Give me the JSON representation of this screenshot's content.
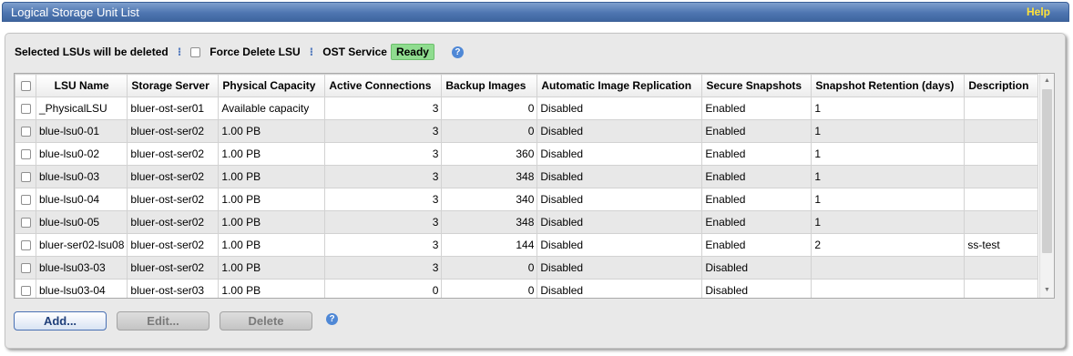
{
  "header": {
    "title": "Logical Storage Unit List",
    "help_label": "Help"
  },
  "toolbar": {
    "selected_label": "Selected LSUs will be deleted",
    "separator": "⁝",
    "force_delete_label": "Force Delete LSU",
    "force_delete_checked": false,
    "ost_service_label": "OST Service",
    "ost_status": "Ready",
    "status_color": "#8fdc8f"
  },
  "table": {
    "columns": [
      "LSU Name",
      "Storage Server",
      "Physical Capacity",
      "Active Connections",
      "Backup Images",
      "Automatic Image Replication",
      "Secure Snapshots",
      "Snapshot Retention (days)",
      "Description"
    ],
    "rows": [
      {
        "name": "_PhysicalLSU",
        "server": "bluer-ost-ser01",
        "capacity": "Available capacity",
        "connections": "3",
        "images": "0",
        "replication": "Disabled",
        "snapshots": "Enabled",
        "retention": "1",
        "description": ""
      },
      {
        "name": "blue-lsu0-01",
        "server": "bluer-ost-ser02",
        "capacity": "1.00 PB",
        "connections": "3",
        "images": "0",
        "replication": "Disabled",
        "snapshots": "Enabled",
        "retention": "1",
        "description": ""
      },
      {
        "name": "blue-lsu0-02",
        "server": "bluer-ost-ser02",
        "capacity": "1.00 PB",
        "connections": "3",
        "images": "360",
        "replication": "Disabled",
        "snapshots": "Enabled",
        "retention": "1",
        "description": ""
      },
      {
        "name": "blue-lsu0-03",
        "server": "bluer-ost-ser02",
        "capacity": "1.00 PB",
        "connections": "3",
        "images": "348",
        "replication": "Disabled",
        "snapshots": "Enabled",
        "retention": "1",
        "description": ""
      },
      {
        "name": "blue-lsu0-04",
        "server": "bluer-ost-ser02",
        "capacity": "1.00 PB",
        "connections": "3",
        "images": "340",
        "replication": "Disabled",
        "snapshots": "Enabled",
        "retention": "1",
        "description": ""
      },
      {
        "name": "blue-lsu0-05",
        "server": "bluer-ost-ser02",
        "capacity": "1.00 PB",
        "connections": "3",
        "images": "348",
        "replication": "Disabled",
        "snapshots": "Enabled",
        "retention": "1",
        "description": ""
      },
      {
        "name": "bluer-ser02-lsu08",
        "server": "bluer-ost-ser02",
        "capacity": "1.00 PB",
        "connections": "3",
        "images": "144",
        "replication": "Disabled",
        "snapshots": "Enabled",
        "retention": "2",
        "description": "ss-test"
      },
      {
        "name": "blue-lsu03-03",
        "server": "bluer-ost-ser02",
        "capacity": "1.00 PB",
        "connections": "3",
        "images": "0",
        "replication": "Disabled",
        "snapshots": "Disabled",
        "retention": "",
        "description": ""
      },
      {
        "name": "blue-lsu03-04",
        "server": "bluer-ost-ser03",
        "capacity": "1.00 PB",
        "connections": "0",
        "images": "0",
        "replication": "Disabled",
        "snapshots": "Disabled",
        "retention": "",
        "description": ""
      }
    ]
  },
  "actions": {
    "add_label": "Add...",
    "edit_label": "Edit...",
    "delete_label": "Delete"
  },
  "icons": {
    "help": "question-mark-icon",
    "scroll_up": "triangle-up-icon",
    "scroll_down": "triangle-down-icon"
  }
}
